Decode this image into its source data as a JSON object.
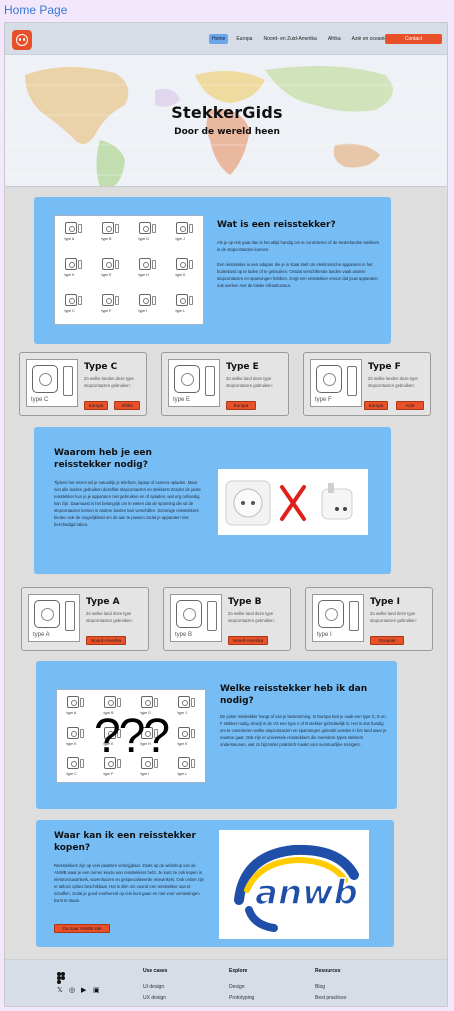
{
  "page": {
    "label": "Home Page"
  },
  "nav": {
    "links": [
      "Home",
      "Europa",
      "Noord- en Zuid-Amerika",
      "Afrika",
      "Azië en oceanië"
    ],
    "contact": "Contact"
  },
  "hero": {
    "title": "StekkerGids",
    "subtitle": "Door de wereld heen"
  },
  "section1": {
    "title": "Wat is een reisstekker?",
    "p1": "Als je op reis gaat dan is het altijd handig om te controleren of de Nederlandse stekkers in de stopcontacten kunnen.",
    "p2": "Een reisstekker is een adapter die je in staat stelt om elektronische apparaten in het buitenland op te laden of te gebruiken. Omdat verschillende landen vaak andere stopcontacten en spanningen hebben, zorgt een reisstekker ervoor dat jouw apparaten ook werken met de lokale infrastructuur.",
    "grid_labels": [
      "type A",
      "type B",
      "type G",
      "type J",
      "type K",
      "type E",
      "type H",
      "type K",
      "type C",
      "type F",
      "type I",
      "type L"
    ]
  },
  "cards_row1": [
    {
      "title": "Type C",
      "img_label": "type C",
      "desc": "Zo welke landen deze type stopcontacten gebruiken:",
      "tags": [
        "Europa",
        "Afrika"
      ]
    },
    {
      "title": "Type E",
      "img_label": "type E",
      "desc": "Zo welke land deze type stopcontacten gebruiken:",
      "tags": [
        "Europa"
      ]
    },
    {
      "title": "Type F",
      "img_label": "type F",
      "desc": "Zo welke landen deze type stopcontacten gebruiken:",
      "tags": [
        "Europa",
        "Azië"
      ]
    }
  ],
  "section2": {
    "title": "Waarom heb je een reisstekker nodig?",
    "text": "Tijdens het reizen wil je natuurlijk je telefoon, laptop of camera opladen. Maar niet alle landen gebruiken dezelfde stopcontacten en stekkers! Zonder de juiste reisstekker kun je je apparaten niet gebruiken en of opladen, wat erg onhandig kan zijn. Daarnaast is het belangrijk om te weten dat de spanning die uit de stopcontacten komen in andere landen kan verschillen. Sommige reisstekkers bieden ook de mogelijkheid om dit aan te passen zodat je apparaten niet beschadigd raken."
  },
  "cards_row2": [
    {
      "title": "Type A",
      "img_label": "type A",
      "desc": "Zo welke land deze type stopcontacten gebruiken:",
      "tags": [
        "Noord-Amerika"
      ]
    },
    {
      "title": "Type B",
      "img_label": "type B",
      "desc": "Zo welke land deze type stopcontacten gebruiken:",
      "tags": [
        "Noord-Amerika"
      ]
    },
    {
      "title": "Type I",
      "img_label": "type I",
      "desc": "Zo welke land deze type stopcontacten gebruiken:",
      "tags": [
        "Oceanië"
      ]
    }
  ],
  "section3": {
    "title": "Welke reisstekker heb ik dan nodig?",
    "text": "De juiste reisstekker hangt af van je bestemming. In Europa heb je vaak een type C, E en F stekker nodig, terwijl in de VS een type A of B stekker gebruikelijk is. Het is dus handig om te controleren welke stopcontacten en spanningen gebruikt worden in het land waar je naartoe gaat. Ook zijn er universele reisstekkers die meerdere types stekkers ondersteunen, wat zo bijzonder praktisch maakt voor avontuurlijke reizigers.",
    "overlay": "???"
  },
  "section4": {
    "title": "Waar kan ik een reisstekker kopen?",
    "text": "Reisstekkers zijn op veel plaatsen verkrijgbaar. Zoals op de webshop van de ANWB waar je een ruimer keuze aan reisstekkers hebt. Je kunt ze ook kopen in elektronicawinkels, warenhuizen en gespecialiseerde reiswinkels. Ook online zijn er talloze opties beschikbaar. Het is slim om vooraf een reisstekker aan te schaffen, zodat je goed voorbereid op reis kunt gaan en niet voor verrassingen komt te staan.",
    "button": "Ga naar ANWB site",
    "logo_text": "anwb"
  },
  "footer": {
    "columns": [
      {
        "title": "Use cases",
        "links": [
          "UI design",
          "UX design"
        ]
      },
      {
        "title": "Explore",
        "links": [
          "Design",
          "Prototyping"
        ]
      },
      {
        "title": "Resources",
        "links": [
          "Blog",
          "Best practices"
        ]
      }
    ]
  },
  "colors": {
    "accent": "#e8502a",
    "section_blue": "#77bdf5",
    "nav_bg": "#d6dde6"
  }
}
